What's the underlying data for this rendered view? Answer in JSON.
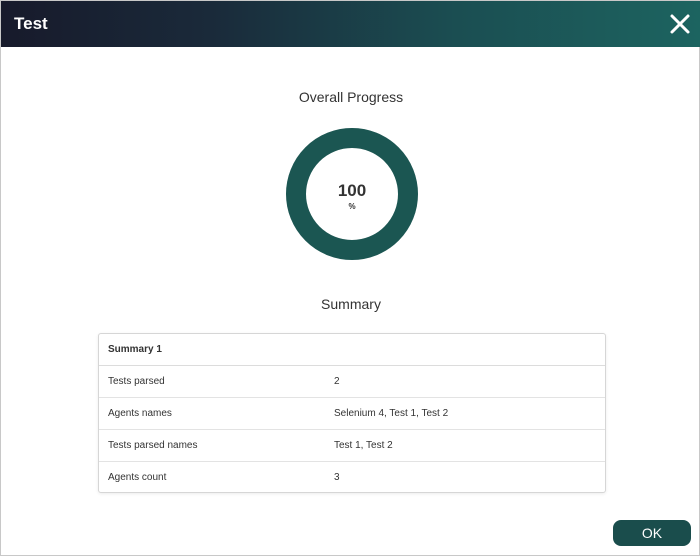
{
  "dialog": {
    "title": "Test",
    "close_icon": "close-icon",
    "ok_label": "OK"
  },
  "progress": {
    "heading": "Overall Progress",
    "value": "100",
    "unit": "%",
    "fraction": 1.0,
    "ring_color": "#1b5652"
  },
  "summary": {
    "heading": "Summary",
    "table_title": "Summary 1",
    "rows": [
      {
        "key": "Tests parsed",
        "value": "2"
      },
      {
        "key": "Agents names",
        "value": "Selenium 4, Test 1, Test 2"
      },
      {
        "key": "Tests parsed names",
        "value": "Test 1, Test 2"
      },
      {
        "key": "Agents count",
        "value": "3"
      }
    ]
  },
  "colors": {
    "titlebar_start": "#171a2b",
    "titlebar_end": "#1c6460",
    "button": "#1a4d4c"
  }
}
